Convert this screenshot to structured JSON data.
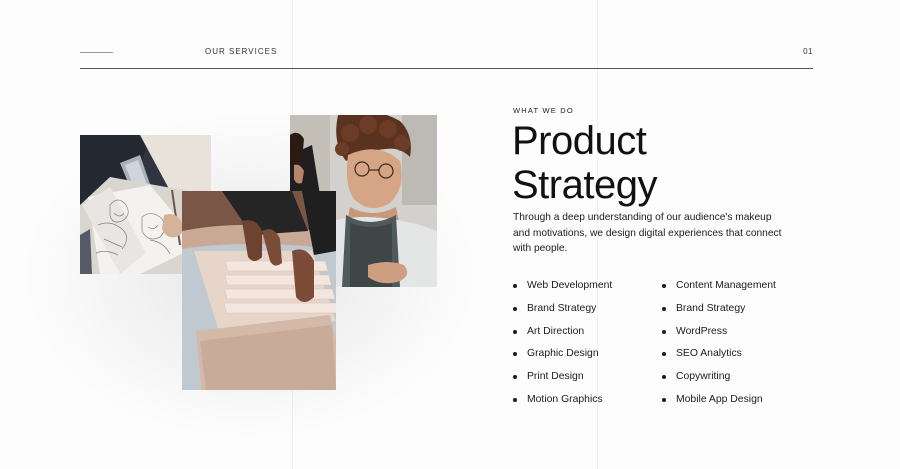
{
  "header": {
    "section_label": "OUR SERVICES",
    "page_number": "01"
  },
  "gallery": {
    "images": [
      "sketch-notebook-photo",
      "woman-glasses-photo",
      "laptop-hands-photo"
    ]
  },
  "content": {
    "eyebrow": "WHAT WE DO",
    "title_line1": "Product",
    "title_line2": "Strategy",
    "description": "Through a deep understanding of our audience's makeup and motivations, we design digital experiences that connect with people.",
    "services_col1": [
      "Web Development",
      "Brand Strategy",
      "Art Direction",
      "Graphic Design",
      "Print Design",
      "Motion Graphics"
    ],
    "services_col2": [
      "Content Management",
      "Brand Strategy",
      "WordPress",
      "SEO Analytics",
      "Copywriting",
      "Mobile App Design"
    ]
  },
  "colors": {
    "text": "#141414",
    "rule": "#555555",
    "background": "#fdfdfd"
  }
}
